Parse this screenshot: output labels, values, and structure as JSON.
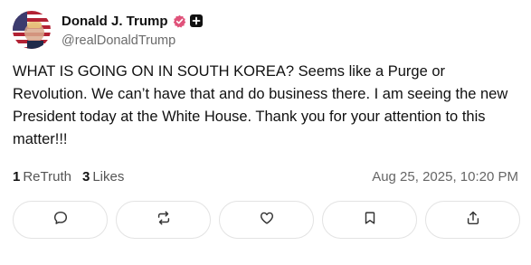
{
  "post": {
    "display_name": "Donald J. Trump",
    "handle": "@realDonaldTrump",
    "text": "WHAT IS GOING ON IN SOUTH KOREA? Seems like a Purge or Revolution. We can’t have that and do business there. I am seeing the new President today at the White House. Thank you for your attention to this matter!!!",
    "retruths_count": "1",
    "retruths_label": "ReTruth",
    "likes_count": "3",
    "likes_label": "Likes",
    "timestamp": "Aug 25, 2025, 10:20 PM"
  },
  "icons": {
    "verified": "verified-badge-icon",
    "plus": "plus-square-icon",
    "reply": "reply-bubble-icon",
    "retruth": "retruth-arrows-icon",
    "like": "heart-icon",
    "bookmark": "bookmark-icon",
    "share": "share-icon"
  },
  "colors": {
    "verified_badge": "#e0527a",
    "text": "#111111",
    "muted": "#666666",
    "border": "#e3e3e3"
  }
}
